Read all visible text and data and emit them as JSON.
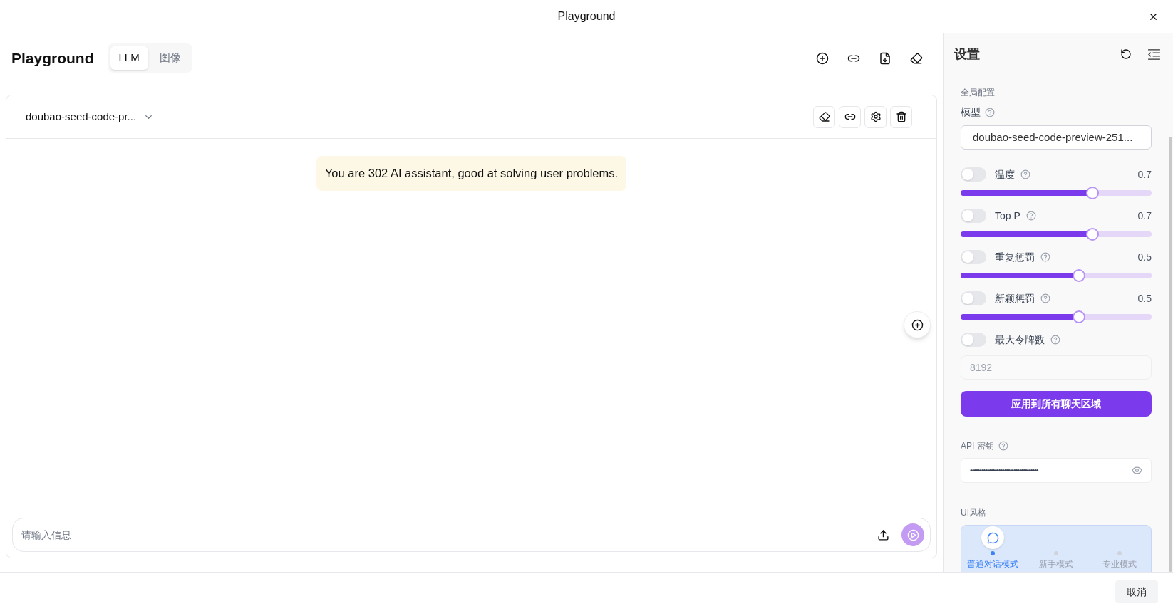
{
  "window": {
    "title": "Playground"
  },
  "header": {
    "title": "Playground",
    "tabs": [
      {
        "label": "LLM",
        "selected": true
      },
      {
        "label": "图像",
        "selected": false
      }
    ]
  },
  "chat": {
    "model": "doubao-seed-code-pr...",
    "messages": [
      {
        "text": "You are 302 AI assistant, good at solving user problems."
      }
    ],
    "input": {
      "placeholder": "请输入信息"
    }
  },
  "settings": {
    "title": "设置",
    "section": "全局配置",
    "model_label": "模型",
    "model_value": "doubao-seed-code-preview-251...",
    "params": [
      {
        "kind": "slider",
        "label": "温度",
        "on": false,
        "reading": "0.7",
        "level": 0.69
      },
      {
        "kind": "slider",
        "label": "Top P",
        "on": false,
        "reading": "0.7",
        "level": 0.69
      },
      {
        "kind": "slider",
        "label": "重复惩罚",
        "on": false,
        "reading": "0.5",
        "level": 0.62
      },
      {
        "kind": "slider",
        "label": "新颖惩罚",
        "on": false,
        "reading": "0.5",
        "level": 0.62
      },
      {
        "kind": "number",
        "label": "最大令牌数",
        "on": false,
        "value": "8192"
      }
    ],
    "apply_button": "应用到所有聊天区域",
    "api_key": {
      "label": "API 密钥",
      "value": "••••••••••••••••••••••••••••••••••••"
    },
    "ui_style": {
      "label": "UI风格",
      "options": [
        {
          "label": "普通对话模式",
          "selected": true
        },
        {
          "label": "新手模式",
          "selected": false
        },
        {
          "label": "专业模式",
          "selected": false
        }
      ]
    }
  },
  "footer": {
    "cancel": "取消"
  }
}
